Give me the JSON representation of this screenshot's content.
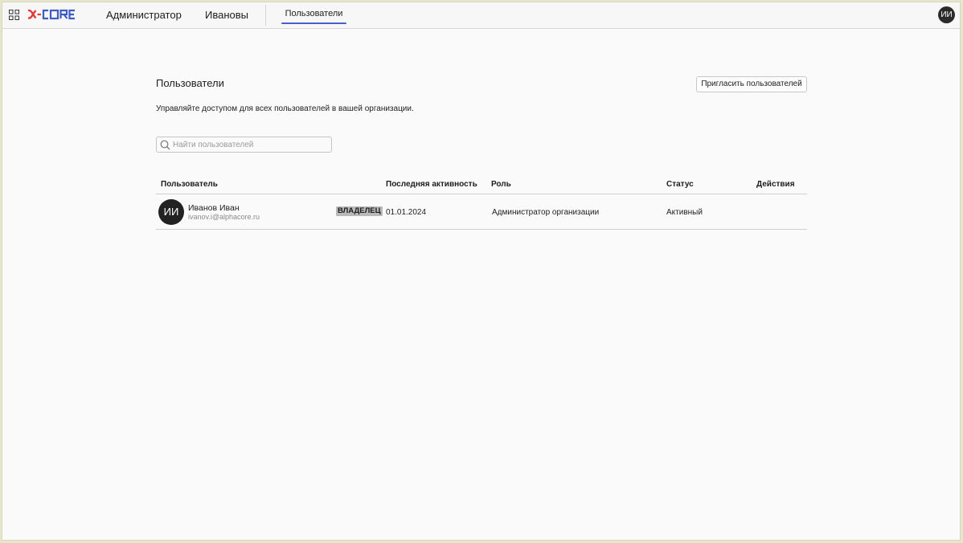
{
  "header": {
    "logo_text": "α-CORE",
    "nav": {
      "admin_label": "Администратор",
      "org_label": "Ивановы"
    },
    "tabs": [
      {
        "label": "Пользователи",
        "active": true
      }
    ],
    "user_avatar": "ИИ"
  },
  "main": {
    "title": "Пользователи",
    "subtitle": "Управляйте доступом для всех пользователей в вашей организации.",
    "invite_button": "Пригласить пользователей",
    "search": {
      "placeholder": "Найти пользователей",
      "value": ""
    },
    "table": {
      "columns": [
        "Пользователь",
        "Последняя активность",
        "Роль",
        "Статус",
        "Действия"
      ],
      "rows": [
        {
          "avatar": "ИИ",
          "name": "Иванов Иван",
          "email": "ivanov.i@alphacore.ru",
          "badge": "ВЛАДЕЛЕЦ",
          "last_activity": "01.01.2024",
          "role": "Администратор организации",
          "status": "Активный",
          "actions": ""
        }
      ]
    }
  },
  "colors": {
    "accent": "#4a5fc9",
    "logo_alpha": "#e03a3a",
    "logo_core": "#3f5bc4",
    "avatar_bg": "#222222",
    "badge_bg": "#b9b9b9"
  },
  "icons": {
    "apps": "grid-icon",
    "search": "search-icon"
  }
}
